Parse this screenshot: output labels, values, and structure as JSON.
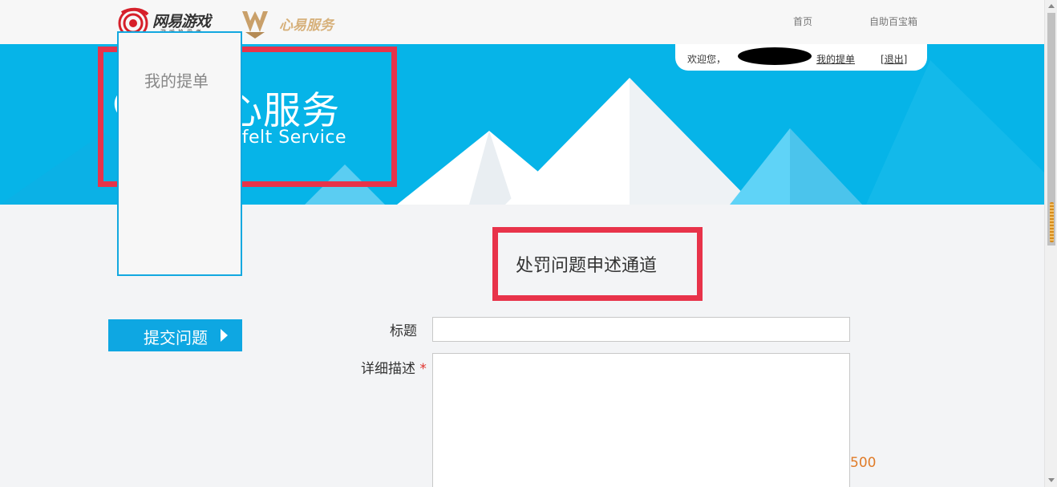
{
  "header": {
    "brand_name": "网易游戏",
    "brand_slogan": "游戏热爱者",
    "service_logo": "心易服务",
    "nav": [
      {
        "label": "首页"
      },
      {
        "label": "自助百宝箱"
      }
    ]
  },
  "banner": {
    "title_cn": "贴心服务",
    "title_en": "Heartfelt Service",
    "icon": "heart-icon"
  },
  "user": {
    "welcome": "欢迎您，",
    "my_tickets": "我的提单",
    "logout": "[退出]"
  },
  "sidebar": {
    "items": [
      {
        "label": "我的提单"
      },
      {
        "label": "提交问题"
      }
    ]
  },
  "form": {
    "page_title": "处罚问题申述通道",
    "title_label": "标题",
    "title_value": "",
    "desc_label": "详细描述",
    "required_mark": "*",
    "desc_value": "",
    "char_counter": "500"
  },
  "colors": {
    "banner": "#06b4e8",
    "accent": "#0ea7e2",
    "highlight": "#e8334a",
    "counter": "#e07b28"
  }
}
